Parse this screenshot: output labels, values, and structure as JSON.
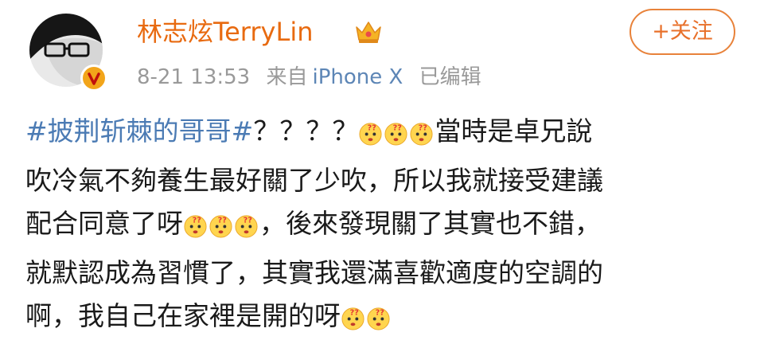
{
  "post": {
    "author": {
      "name": "林志炫TerryLin",
      "avatar": "avatar-photo",
      "verified_icon": "v-badge-icon",
      "vip_icon": "crown-icon"
    },
    "meta": {
      "date": "8-21 13:53",
      "source_prefix": "来自",
      "source": "iPhone X",
      "edited": "已编辑"
    },
    "follow_button": "+关注",
    "content": {
      "topic": "#披荆斩棘的哥哥#",
      "l1_text": "？？？？",
      "l1_after": "當時是卓兄說",
      "l2": "吹冷氣不夠養生最好關了少吹，所以我就接受建議",
      "l3_before": "配合同意了呀",
      "l3_after": "，後來發現關了其實也不錯，",
      "l4": "就默認成為習慣了，其實我還滿喜歡適度的空調的",
      "l5_before": "啊，我自己在家裡是開的呀",
      "emoji_icon": "confused-emoji-icon"
    }
  },
  "colors": {
    "username": "#e86a10",
    "topic": "#4b7bb4",
    "meta": "#999999",
    "follow_border": "#e8823a"
  }
}
